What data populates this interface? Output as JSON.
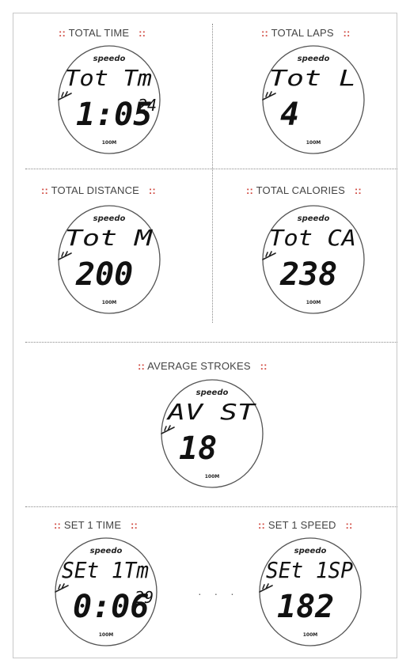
{
  "marker": "::",
  "brand": "speedo",
  "footer": "100M",
  "ellipsis": "· · ·",
  "panels": [
    {
      "label": "TOTAL TIME",
      "line1": "Tot Tm",
      "line2": "1:05",
      "sup": "24"
    },
    {
      "label": "TOTAL LAPS",
      "line1": "Tot L",
      "line2": "4",
      "sup": ""
    },
    {
      "label": "TOTAL DISTANCE",
      "line1": "Tot M",
      "line2": "200",
      "sup": ""
    },
    {
      "label": "TOTAL CALORIES",
      "line1": "Tot CA",
      "line2": "238",
      "sup": ""
    },
    {
      "label": "AVERAGE STROKES",
      "line1": "AV ST",
      "line2": "18",
      "sup": ""
    },
    {
      "label": "SET 1 TIME",
      "line1": "SEt 1Tm",
      "line2": "0:06",
      "sup": "29"
    },
    {
      "label": "SET 1 SPEED",
      "line1": "SEt 1SP",
      "line2": "182",
      "sup": ""
    }
  ]
}
